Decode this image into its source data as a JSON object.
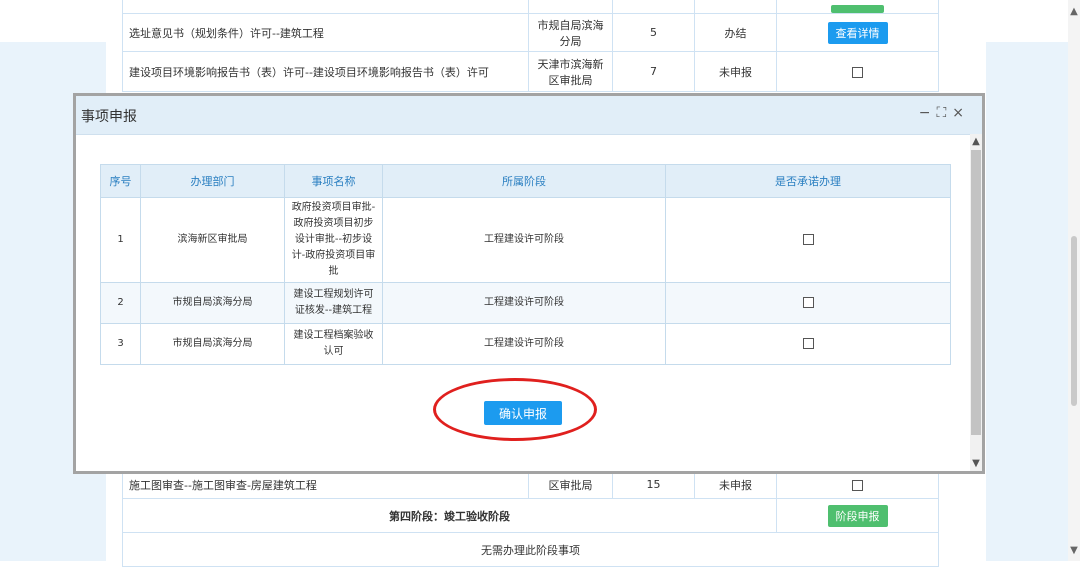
{
  "background_table_top": {
    "rows": [
      {
        "name": "选址意见书（规划条件）许可--建筑工程",
        "dept": "市规自局滨海分局",
        "days": "5",
        "status": "办结",
        "action": "查看详情"
      },
      {
        "name": "建设项目环境影响报告书（表）许可--建设项目环境影响报告书（表）许可",
        "dept": "天津市滨海新区审批局",
        "days": "7",
        "status": "未申报"
      }
    ]
  },
  "background_table_bottom": {
    "row": {
      "name": "施工图审查--施工图审查-房屋建筑工程",
      "dept": "区审批局",
      "days": "15",
      "status": "未申报"
    },
    "stage_label": "第四阶段：竣工验收阶段",
    "stage_button": "阶段申报",
    "empty_text": "无需办理此阶段事项"
  },
  "modal": {
    "title": "事项申报",
    "controls": {
      "minimize": "−",
      "maximize": "⛶",
      "close": "×"
    },
    "headers": {
      "index": "序号",
      "dept": "办理部门",
      "name": "事项名称",
      "stage": "所属阶段",
      "promise": "是否承诺办理"
    },
    "rows": [
      {
        "index": "1",
        "dept": "滨海新区审批局",
        "name": "政府投资项目审批-政府投资项目初步设计审批--初步设计-政府投资项目审批",
        "stage": "工程建设许可阶段"
      },
      {
        "index": "2",
        "dept": "市规自局滨海分局",
        "name": "建设工程规划许可证核发--建筑工程",
        "stage": "工程建设许可阶段"
      },
      {
        "index": "3",
        "dept": "市规自局滨海分局",
        "name": "建设工程档案验收认可",
        "stage": "工程建设许可阶段"
      }
    ],
    "confirm_label": "确认申报"
  },
  "colors": {
    "primary": "#1c9bef",
    "success": "#4fbf6f",
    "annotation": "#e0201e",
    "header_bg": "#e1eef8"
  }
}
